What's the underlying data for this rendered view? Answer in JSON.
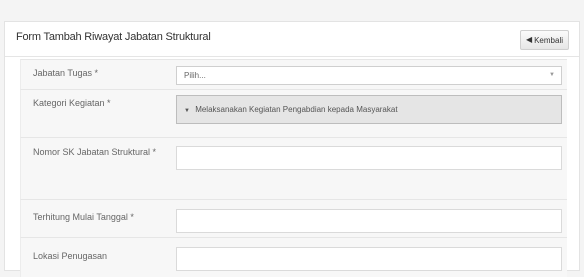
{
  "form": {
    "title": "Form Tambah Riwayat Jabatan Struktural",
    "back_label": "Kembali",
    "fields": {
      "jabatan_tugas": {
        "label": "Jabatan Tugas *",
        "placeholder": "Pilih..."
      },
      "kategori_kegiatan": {
        "label": "Kategori Kegiatan *",
        "value": "Melaksanakan Kegiatan Pengabdian kepada Masyarakat"
      },
      "nomor_sk": {
        "label": "Nomor SK Jabatan Struktural *",
        "value": ""
      },
      "terhitung_mulai": {
        "label": "Terhitung Mulai Tanggal *",
        "value": ""
      },
      "lokasi_penugasan": {
        "label": "Lokasi Penugasan",
        "value": ""
      }
    }
  }
}
